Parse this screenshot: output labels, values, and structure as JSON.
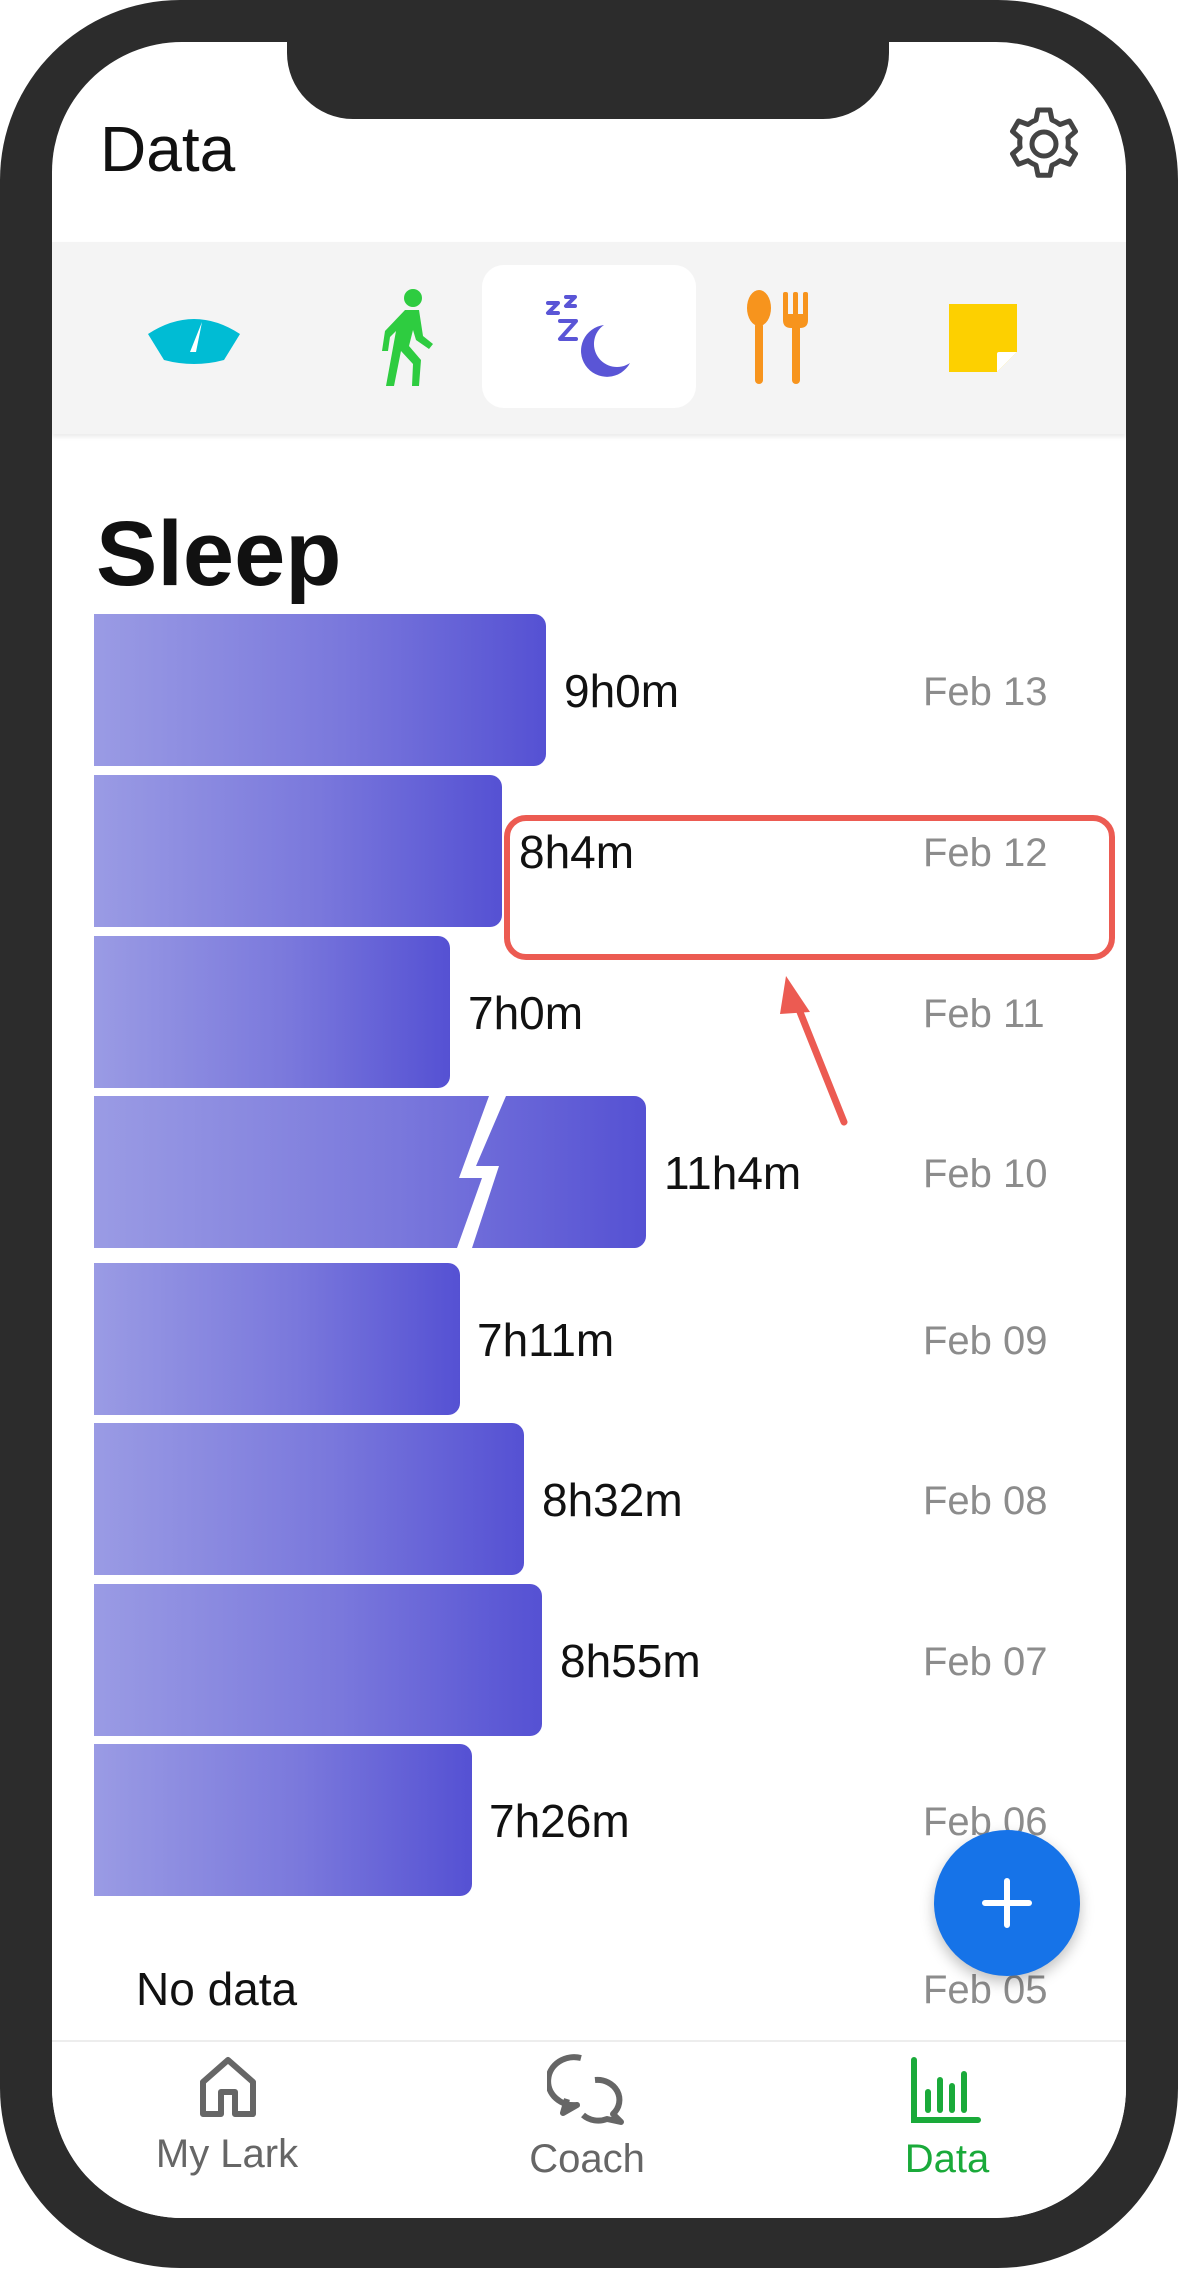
{
  "header": {
    "title": "Data",
    "settings_icon": "gear-icon"
  },
  "categories": [
    {
      "name": "weight",
      "icon": "scale-icon",
      "color": "#00bcd4",
      "active": false
    },
    {
      "name": "activity",
      "icon": "walking-icon",
      "color": "#2ecc40",
      "active": false
    },
    {
      "name": "sleep",
      "icon": "sleep-moon-icon",
      "color": "#5a55d6",
      "active": true
    },
    {
      "name": "meals",
      "icon": "utensils-icon",
      "color": "#f7941d",
      "active": false
    },
    {
      "name": "notes",
      "icon": "note-icon",
      "color": "#fdd000",
      "active": false
    }
  ],
  "sleep": {
    "title": "Sleep",
    "bar_gradient": [
      "#9a9be4",
      "#5551d3"
    ],
    "entries": [
      {
        "duration": "9h0m",
        "date": "Feb 13",
        "minutes": 540
      },
      {
        "duration": "8h4m",
        "date": "Feb 12",
        "minutes": 484,
        "highlighted": true
      },
      {
        "duration": "7h0m",
        "date": "Feb 11",
        "minutes": 420
      },
      {
        "duration": "11h4m",
        "date": "Feb 10",
        "minutes": 664,
        "truncated": true
      },
      {
        "duration": "7h11m",
        "date": "Feb 09",
        "minutes": 431
      },
      {
        "duration": "8h32m",
        "date": "Feb 08",
        "minutes": 512
      },
      {
        "duration": "8h55m",
        "date": "Feb 07",
        "minutes": 535
      },
      {
        "duration": "7h26m",
        "date": "Feb 06",
        "minutes": 446
      }
    ],
    "no_data": {
      "label": "No data",
      "date": "Feb 05"
    }
  },
  "fab": {
    "icon": "plus-icon",
    "color": "#1673e8"
  },
  "bottom_nav": {
    "items": [
      {
        "label": "My Lark",
        "icon": "home-icon",
        "active": false
      },
      {
        "label": "Coach",
        "icon": "chat-bubbles-icon",
        "active": false
      },
      {
        "label": "Data",
        "icon": "bar-chart-icon",
        "active": true
      }
    ],
    "active_color": "#1aaa3a",
    "inactive_color": "#666666"
  },
  "annotation": {
    "highlight_color": "#ec5b52"
  }
}
